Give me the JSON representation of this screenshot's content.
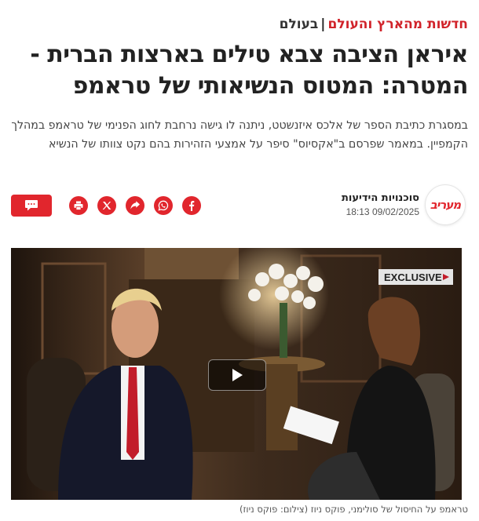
{
  "breadcrumb": {
    "section": "חדשות מהארץ והעולם",
    "separator": "|",
    "subsection": "בעולם"
  },
  "article": {
    "title": "איראן הציבה צבא טילים בארצות הברית - המטרה: המטוס הנשיאותי של טראמפ",
    "subtitle": "במסגרת כתיבת הספר של אלכס איזנשטט, ניתנה לו גישה נרחבת לחוג הפנימי של טראמפ במהלך הקמפיין. במאמר שפרסם ב\"אקסיוס\" סיפר על אמצעי הזהירות בהם נקט צוותו של הנשיא"
  },
  "author": {
    "logo_text": "מעריב",
    "name": "סוכנויות הידיעות",
    "date": "09/02/2025 18:13"
  },
  "share_icons": [
    "facebook-icon",
    "whatsapp-icon",
    "share-icon",
    "x-icon",
    "print-icon"
  ],
  "comment_icon": "comment-icon",
  "video": {
    "badge": "EXCLUSIVE",
    "play_icon": "play-icon"
  },
  "caption": "טראמפ על החיסול של סולימני, פוקס ניוז (צילום: פוקס ניוז)",
  "colors": {
    "accent": "#e1262d",
    "breadcrumb_red": "#d1232a",
    "text": "#222222"
  }
}
